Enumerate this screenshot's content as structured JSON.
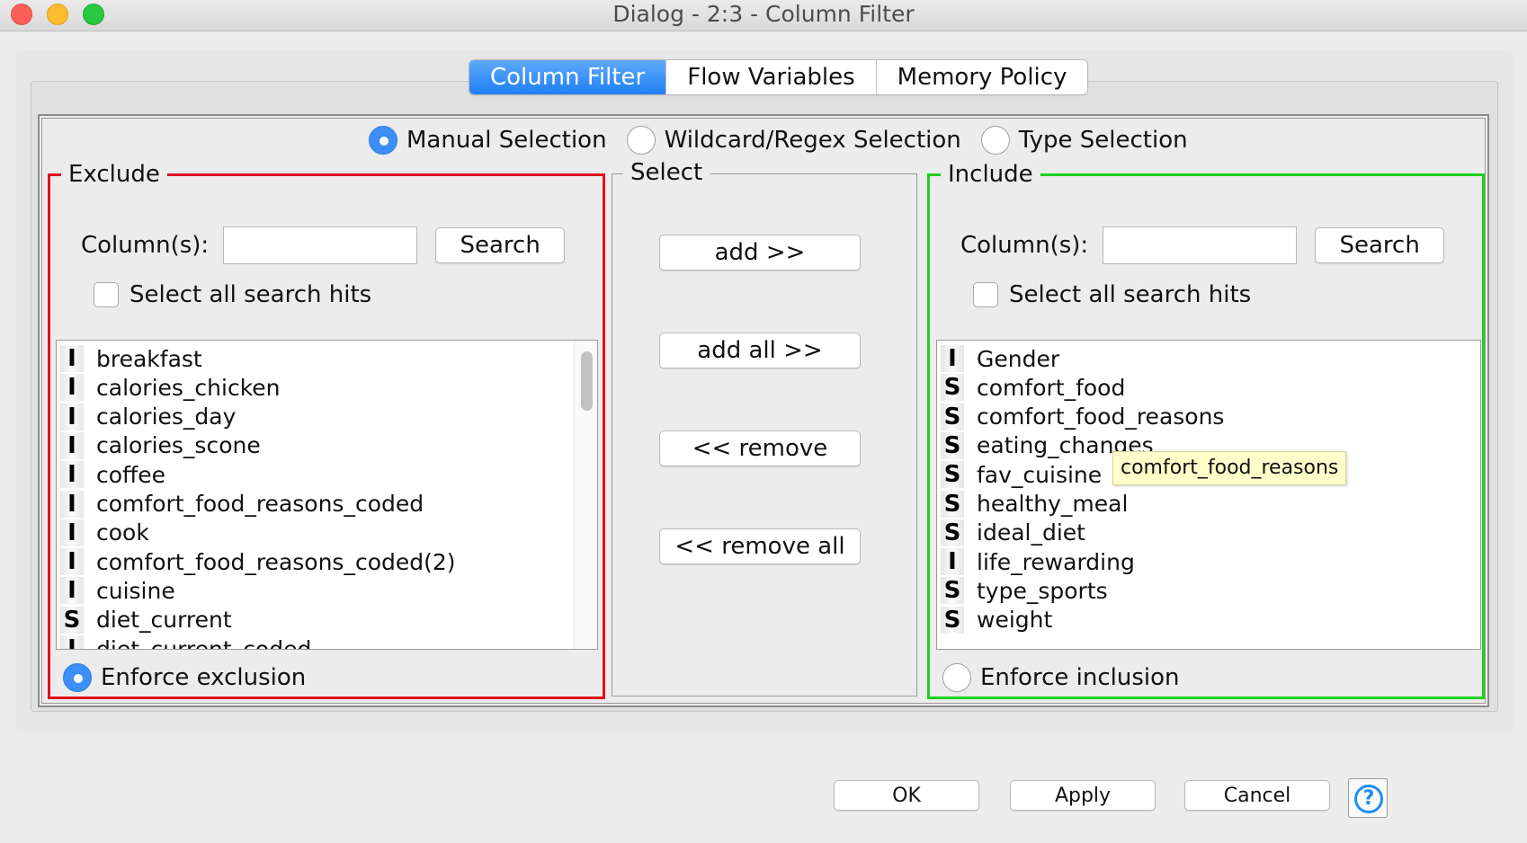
{
  "window": {
    "title": "Dialog - 2:3 - Column Filter"
  },
  "tabs": [
    {
      "label": "Column Filter",
      "active": true
    },
    {
      "label": "Flow Variables",
      "active": false
    },
    {
      "label": "Memory Policy",
      "active": false
    }
  ],
  "selection_modes": [
    {
      "label": "Manual Selection",
      "selected": true
    },
    {
      "label": "Wildcard/Regex Selection",
      "selected": false
    },
    {
      "label": "Type Selection",
      "selected": false
    }
  ],
  "exclude": {
    "legend": "Exclude",
    "column_label": "Column(s):",
    "search_value": "",
    "search_button": "Search",
    "select_all_label": "Select all search hits",
    "select_all_checked": false,
    "items": [
      {
        "type": "I",
        "name": "breakfast"
      },
      {
        "type": "I",
        "name": "calories_chicken"
      },
      {
        "type": "I",
        "name": "calories_day"
      },
      {
        "type": "I",
        "name": "calories_scone"
      },
      {
        "type": "I",
        "name": "coffee"
      },
      {
        "type": "I",
        "name": "comfort_food_reasons_coded"
      },
      {
        "type": "I",
        "name": "cook"
      },
      {
        "type": "I",
        "name": "comfort_food_reasons_coded(2)"
      },
      {
        "type": "I",
        "name": "cuisine"
      },
      {
        "type": "S",
        "name": "diet_current"
      },
      {
        "type": "I",
        "name": "diet_current_coded"
      }
    ],
    "enforce_label": "Enforce exclusion",
    "enforce_selected": true,
    "border_color": "#e0121e"
  },
  "select": {
    "legend": "Select",
    "buttons": [
      "add >>",
      "add all >>",
      "<< remove",
      "<< remove all"
    ]
  },
  "include": {
    "legend": "Include",
    "column_label": "Column(s):",
    "search_value": "",
    "search_button": "Search",
    "select_all_label": "Select all search hits",
    "select_all_checked": false,
    "items": [
      {
        "type": "I",
        "name": "Gender"
      },
      {
        "type": "S",
        "name": "comfort_food"
      },
      {
        "type": "S",
        "name": "comfort_food_reasons"
      },
      {
        "type": "S",
        "name": "eating_changes"
      },
      {
        "type": "S",
        "name": "fav_cuisine"
      },
      {
        "type": "S",
        "name": "healthy_meal"
      },
      {
        "type": "S",
        "name": "ideal_diet"
      },
      {
        "type": "I",
        "name": "life_rewarding"
      },
      {
        "type": "S",
        "name": "type_sports"
      },
      {
        "type": "S",
        "name": "weight"
      }
    ],
    "enforce_label": "Enforce inclusion",
    "enforce_selected": false,
    "border_color": "#1cd11c"
  },
  "tooltip": {
    "text": "comfort_food_reasons"
  },
  "footer": {
    "ok": "OK",
    "apply": "Apply",
    "cancel": "Cancel",
    "help_glyph": "?"
  },
  "colors": {
    "accent": "#2f86f6",
    "exclude_border": "#e0121e",
    "include_border": "#1cd11c",
    "tooltip_bg": "#fffecb"
  }
}
